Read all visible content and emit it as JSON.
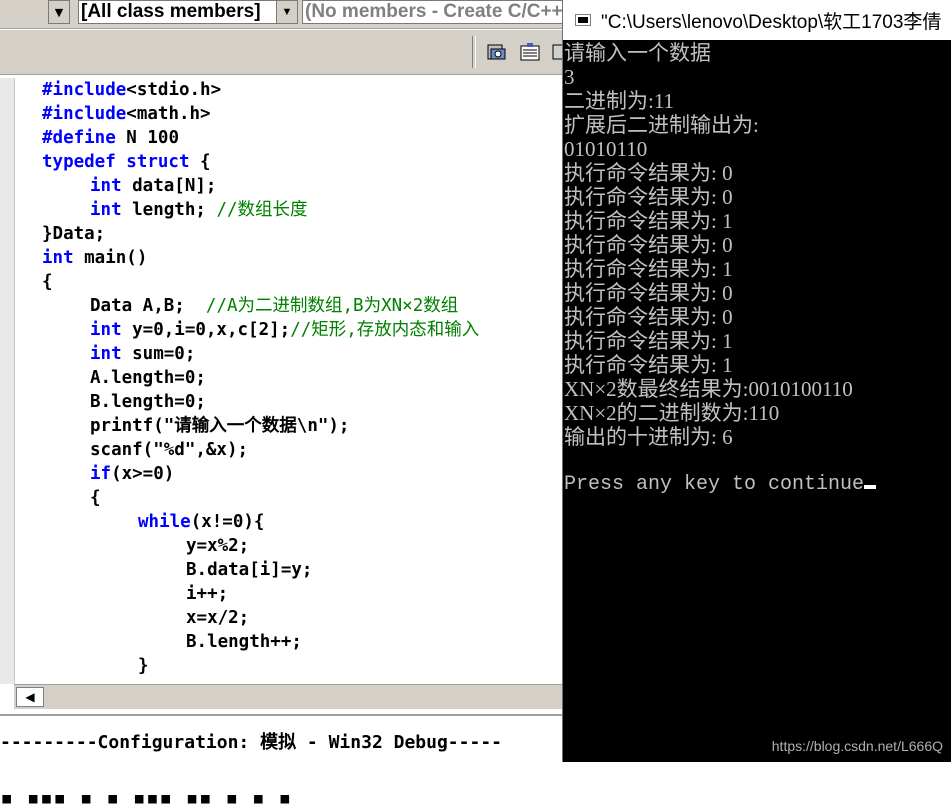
{
  "wizard_bar": {
    "class_members": "[All class members]",
    "members": "(No members - Create C/C++"
  },
  "editor": {
    "lines": [
      {
        "kw": "#include",
        "rest": "<stdio.h>"
      },
      {
        "kw": "#include",
        "rest": "<math.h>"
      },
      {
        "kw": "#define",
        "rest": " N 100"
      },
      {
        "kw": "typedef struct",
        "rest": " {"
      },
      {
        "kw": "int",
        "rest": " data[N];"
      },
      {
        "kw": "int",
        "rest": " length; ",
        "comment": "//数组长度"
      },
      {
        "rest": "}Data;"
      },
      {
        "kw": "int",
        "rest": " main()"
      },
      {
        "rest": "{"
      },
      {
        "rest": "Data A,B;  ",
        "comment": "//A为二进制数组,B为XN×2数组"
      },
      {
        "kw": "int",
        "rest": " y=0,i=0,x,c[2];",
        "comment": "//矩形,存放内态和输入"
      },
      {
        "kw": "int",
        "rest": " sum=0;"
      },
      {
        "rest": "A.length=0;"
      },
      {
        "rest": "B.length=0;"
      },
      {
        "rest": "printf(\"请输入一个数据\\n\");"
      },
      {
        "rest": "scanf(\"%d\",&x);"
      },
      {
        "kw": "if",
        "rest": "(x>=0)"
      },
      {
        "rest": "{"
      },
      {
        "kw": "while",
        "rest": "(x!=0){"
      },
      {
        "rest": "y=x%2;"
      },
      {
        "rest": "B.data[i]=y;"
      },
      {
        "rest": "i++;"
      },
      {
        "rest": "x=x/2;"
      },
      {
        "rest": "B.length++;"
      },
      {
        "rest": "}"
      }
    ]
  },
  "build_bar": {
    "text": "---------Configuration: 模拟 - Win32 Debug-----"
  },
  "console": {
    "title": "\"C:\\Users\\lenovo\\Desktop\\软工1703李倩",
    "lines": [
      "请输入一个数据",
      "3",
      "二进制为:11",
      "扩展后二进制输出为:",
      "01010110",
      "执行命令结果为: 0",
      "执行命令结果为: 0",
      "执行命令结果为: 1",
      "执行命令结果为: 0",
      "执行命令结果为: 1",
      "执行命令结果为: 0",
      "执行命令结果为: 0",
      "执行命令结果为: 1",
      "执行命令结果为: 1",
      "XN×2数最终结果为:0010100110",
      "XN×2的二进制数为:110",
      "输出的十进制为: 6",
      ""
    ],
    "prompt": "Press any key to continue"
  },
  "watermark": "https://blog.csdn.net/L666Q"
}
